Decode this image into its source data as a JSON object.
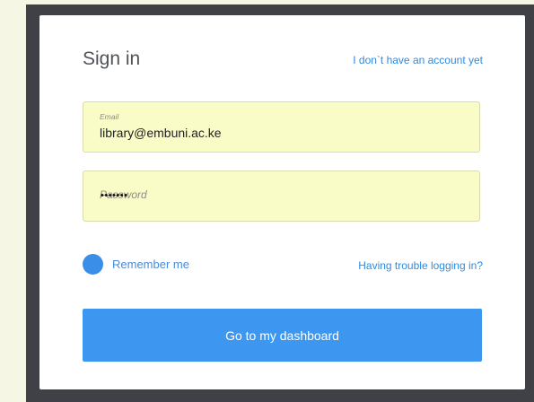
{
  "sign_in": {
    "title": "Sign in",
    "no_account_link": "I don`t have an account yet",
    "email": {
      "label": "Email",
      "value": "library@embuni.ac.ke"
    },
    "password": {
      "placeholder": "Password",
      "mask": "•••••••"
    },
    "remember_label": "Remember me",
    "trouble_link": "Having trouble logging in?",
    "submit_label": "Go to my dashboard"
  },
  "colors": {
    "accent": "#3d97f0",
    "field_background": "#fafcc8",
    "frame": "#3f4146",
    "page_background": "#f5f6e4"
  }
}
